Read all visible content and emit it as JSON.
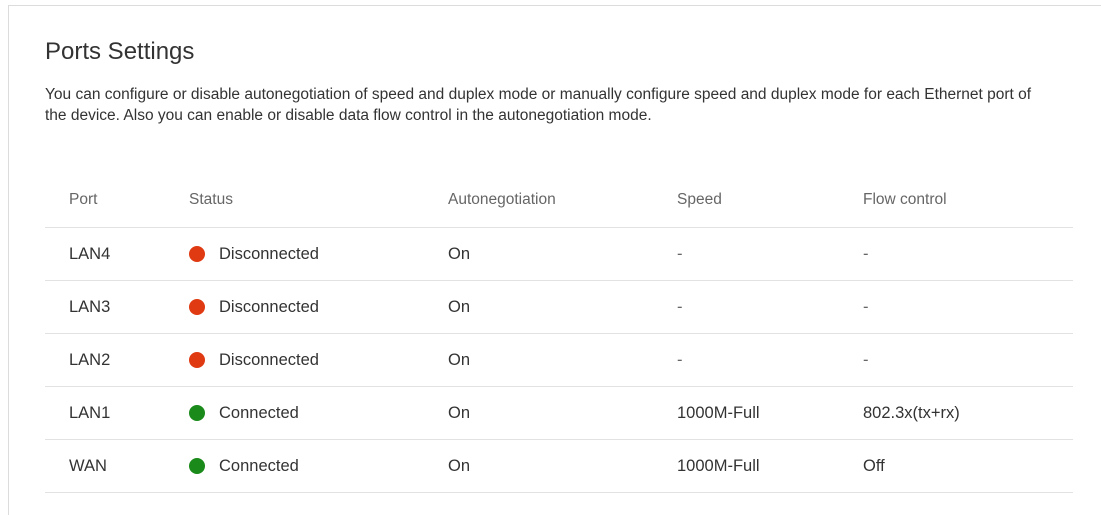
{
  "page": {
    "title": "Ports Settings",
    "description": "You can configure or disable autonegotiation of speed and duplex mode or manually configure speed and duplex mode for each Ethernet port of the device. Also you can enable or disable data flow control in the autonegotiation mode."
  },
  "table": {
    "headers": {
      "port": "Port",
      "status": "Status",
      "autonegotiation": "Autonegotiation",
      "speed": "Speed",
      "flow_control": "Flow control"
    },
    "rows": [
      {
        "port": "LAN4",
        "status": "Disconnected",
        "status_color": "#e03a12",
        "status_icon": "status-disconnected-icon",
        "autonegotiation": "On",
        "speed": "-",
        "flow_control": "-"
      },
      {
        "port": "LAN3",
        "status": "Disconnected",
        "status_color": "#e03a12",
        "status_icon": "status-disconnected-icon",
        "autonegotiation": "On",
        "speed": "-",
        "flow_control": "-"
      },
      {
        "port": "LAN2",
        "status": "Disconnected",
        "status_color": "#e03a12",
        "status_icon": "status-disconnected-icon",
        "autonegotiation": "On",
        "speed": "-",
        "flow_control": "-"
      },
      {
        "port": "LAN1",
        "status": "Connected",
        "status_color": "#1a8a1a",
        "status_icon": "status-connected-icon",
        "autonegotiation": "On",
        "speed": "1000M-Full",
        "flow_control": "802.3x(tx+rx)"
      },
      {
        "port": "WAN",
        "status": "Connected",
        "status_color": "#1a8a1a",
        "status_icon": "status-connected-icon",
        "autonegotiation": "On",
        "speed": "1000M-Full",
        "flow_control": "Off"
      }
    ]
  }
}
